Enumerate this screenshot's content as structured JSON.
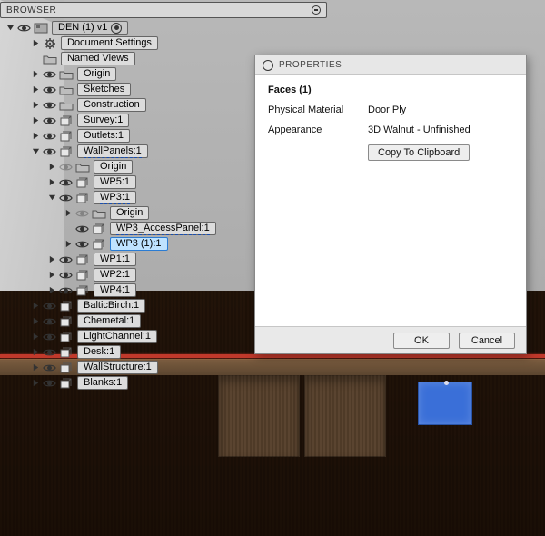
{
  "browser": {
    "title": "BROWSER"
  },
  "tree": {
    "root": {
      "label": "DEN (1) v1"
    },
    "items": [
      {
        "depth": 1,
        "tw": "r",
        "eye": null,
        "ico": "gear",
        "label": "Document Settings"
      },
      {
        "depth": 1,
        "tw": null,
        "eye": null,
        "ico": "folder",
        "label": "Named Views"
      },
      {
        "depth": 1,
        "tw": "r",
        "eye": "on",
        "ico": "folder",
        "label": "Origin"
      },
      {
        "depth": 1,
        "tw": "r",
        "eye": "on",
        "ico": "folder",
        "label": "Sketches"
      },
      {
        "depth": 1,
        "tw": "r",
        "eye": "on",
        "ico": "folder",
        "label": "Construction"
      },
      {
        "depth": 1,
        "tw": "r",
        "eye": "on",
        "ico": "comp",
        "label": "Survey:1"
      },
      {
        "depth": 1,
        "tw": "r",
        "eye": "on",
        "ico": "comp",
        "label": "Outlets:1"
      },
      {
        "depth": 1,
        "tw": "d",
        "eye": "on",
        "ico": "comp",
        "label": "WallPanels:1",
        "dash": true
      },
      {
        "depth": 2,
        "tw": "r",
        "eye": "off",
        "ico": "folder",
        "label": "Origin"
      },
      {
        "depth": 2,
        "tw": "r",
        "eye": "on",
        "ico": "comp",
        "label": "WP5:1"
      },
      {
        "depth": 2,
        "tw": "d",
        "eye": "on",
        "ico": "comp",
        "label": "WP3:1",
        "dash": true
      },
      {
        "depth": 3,
        "tw": "r",
        "eye": "off",
        "ico": "folder",
        "label": "Origin"
      },
      {
        "depth": 3,
        "tw": null,
        "eye": "on",
        "ico": "comp",
        "label": "WP3_AccessPanel:1",
        "dash": true
      },
      {
        "depth": 3,
        "tw": "r",
        "eye": "on",
        "ico": "comp",
        "label": "WP3 (1):1",
        "sel": true
      },
      {
        "depth": 2,
        "tw": "r",
        "eye": "on",
        "ico": "comp",
        "label": "WP1:1"
      },
      {
        "depth": 2,
        "tw": "r",
        "eye": "on",
        "ico": "comp",
        "label": "WP2:1"
      },
      {
        "depth": 2,
        "tw": "r",
        "eye": "on",
        "ico": "comp",
        "label": "WP4:1"
      },
      {
        "depth": 1,
        "tw": "r",
        "eye": "on",
        "ico": "comp",
        "label": "BalticBirch:1"
      },
      {
        "depth": 1,
        "tw": "r",
        "eye": "on",
        "ico": "comp",
        "label": "Chemetal:1"
      },
      {
        "depth": 1,
        "tw": "r",
        "eye": "on",
        "ico": "comp",
        "label": "LightChannel:1"
      },
      {
        "depth": 1,
        "tw": "r",
        "eye": "on",
        "ico": "comp",
        "label": "Desk:1"
      },
      {
        "depth": 1,
        "tw": "r",
        "eye": "on",
        "ico": "comp",
        "label": "WallStructure:1"
      },
      {
        "depth": 1,
        "tw": "r",
        "eye": "on",
        "ico": "comp",
        "label": "Blanks:1"
      }
    ]
  },
  "properties": {
    "title": "PROPERTIES",
    "header": "Faces (1)",
    "rows": [
      {
        "k": "Physical Material",
        "v": "Door Ply"
      },
      {
        "k": "Appearance",
        "v": "3D Walnut - Unfinished"
      }
    ],
    "copy_btn": "Copy To Clipboard",
    "ok": "OK",
    "cancel": "Cancel"
  }
}
